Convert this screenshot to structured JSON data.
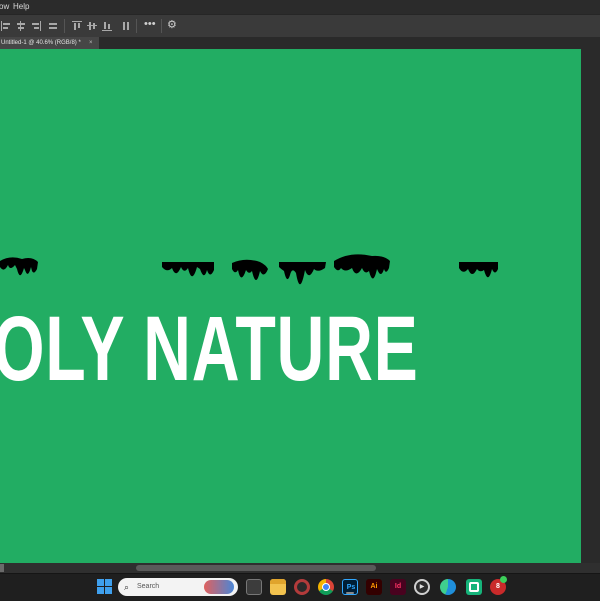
{
  "menubar": {
    "items": [
      "ow",
      "Help"
    ]
  },
  "options_bar": {
    "more_label": "•••",
    "icons": [
      "align-left-icon",
      "align-center-h-icon",
      "align-right-icon",
      "distribute-icon",
      "align-top-icon",
      "align-middle-v-icon",
      "align-bottom-icon",
      "distribute-spacing-icon",
      "more-options-icon",
      "gear-icon"
    ]
  },
  "document_tab": {
    "title": "Untitled-1 @ 40.6% (RGB/8) *",
    "close": "×"
  },
  "canvas": {
    "background_color": "#22ad63",
    "text": "OLY NATURE",
    "text_color": "#ffffff",
    "drip_color": "#000000"
  },
  "taskbar": {
    "search_label": "Search",
    "search_icon": "⌕",
    "apps": [
      {
        "name": "start-icon"
      },
      {
        "name": "task-view-icon"
      },
      {
        "name": "file-explorer-icon"
      },
      {
        "name": "red-app-icon"
      },
      {
        "name": "chrome-icon"
      },
      {
        "name": "photoshop-icon",
        "label": "Ps"
      },
      {
        "name": "illustrator-icon",
        "label": "Ai"
      },
      {
        "name": "indesign-icon",
        "label": "Id"
      },
      {
        "name": "media-player-icon",
        "label": "▶"
      },
      {
        "name": "edge-icon"
      },
      {
        "name": "green-app-icon"
      },
      {
        "name": "notification-app-icon",
        "label": "8"
      }
    ]
  }
}
